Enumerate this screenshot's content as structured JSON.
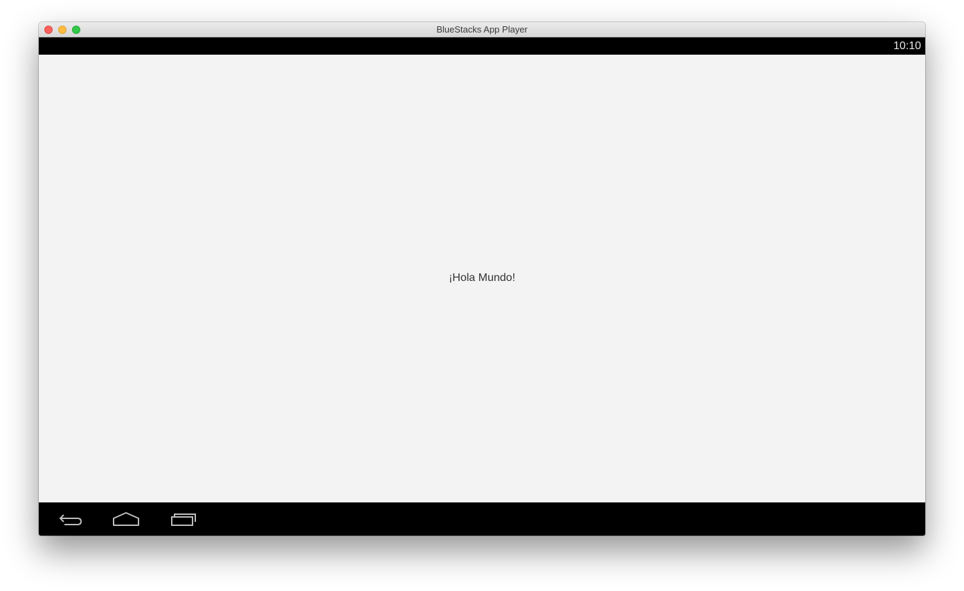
{
  "window": {
    "title": "BlueStacks App Player"
  },
  "status_bar": {
    "time": "10:10"
  },
  "content": {
    "message": "¡Hola Mundo!"
  },
  "nav_bar": {
    "buttons": [
      {
        "name": "back",
        "icon": "back-arrow-icon"
      },
      {
        "name": "home",
        "icon": "home-icon"
      },
      {
        "name": "recent",
        "icon": "recent-apps-icon"
      }
    ]
  },
  "colors": {
    "content_background": "#f3f3f3",
    "bars": "#000000",
    "close": "#fc605c",
    "minimize": "#fdbc40",
    "maximize": "#34c84a",
    "nav_icon": "#bdbdbd"
  }
}
